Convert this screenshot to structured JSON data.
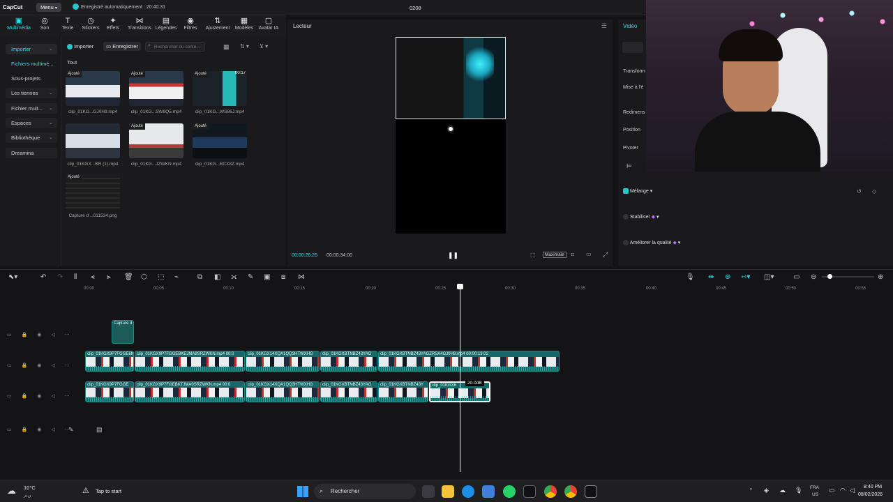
{
  "topbar": {
    "logo": "CapCut",
    "menu": "Menu",
    "autosave": "Enregistré automatiquement : 20:40:31",
    "project_title": "0208"
  },
  "toolbar": {
    "tools": [
      "Multimédia",
      "Son",
      "Texte",
      "Stickers",
      "Effets",
      "Transitions",
      "Légendes",
      "Filtres",
      "Ajustement",
      "Modèles",
      "Avatar IA"
    ]
  },
  "sidebar": {
    "items": [
      {
        "label": "Importer",
        "chevron": true
      },
      {
        "label": "Fichiers multimé...",
        "chevron": false
      },
      {
        "label": "Sous-projets",
        "chevron": false
      },
      {
        "label": "Les tiennes",
        "chevron": true
      },
      {
        "label": "Fichier mult...",
        "chevron": true
      },
      {
        "label": "Espaces",
        "chevron": true
      },
      {
        "label": "Bibliothèque",
        "chevron": true
      },
      {
        "label": "Dreamina",
        "chevron": false
      }
    ]
  },
  "media": {
    "import_btn": "Importer",
    "record_btn": "Enregistrer",
    "search_placeholder": "Rechercher du conte...",
    "filter_all": "Tout",
    "badge": "Ajouté",
    "items": [
      {
        "name": "clip_01KG...GJ0H9.mp4",
        "duration": ""
      },
      {
        "name": "clip_01KG...SW9Q5.mp4",
        "duration": ""
      },
      {
        "name": "clip_01KG...WS86J.mp4",
        "duration": "00:17"
      },
      {
        "name": "clip_01KGX...BR (1).mp4",
        "duration": ""
      },
      {
        "name": "clip_01KG...JZWKN.mp4",
        "duration": ""
      },
      {
        "name": "clip_01KG...BCX8Z.mp4",
        "duration": ""
      },
      {
        "name": "Capture d'...011534.png",
        "duration": ""
      }
    ]
  },
  "player": {
    "title": "Lecteur",
    "current_time": "00:00:26:25",
    "total_time": "00:00:34:00",
    "ratio_btn": "Maximale"
  },
  "props": {
    "tab": "Vidéo",
    "labels": [
      "Transform",
      "Mise à l'é",
      "Redimens",
      "Position",
      "Pivoter"
    ],
    "blend": "Mélange",
    "stabilize": "Stabiliser",
    "enhance": "Améliorer la qualité"
  },
  "timeline": {
    "ticks": [
      "00:00",
      "00:05",
      "00:10",
      "00:15",
      "00:20",
      "00:25",
      "00:30",
      "00:35",
      "00:40",
      "00:45",
      "00:50",
      "00:55"
    ],
    "caption_clip": "Capture d",
    "track1_labels": [
      "clip_01KGX9P7FGGE6K",
      "clip_01KGX9P7FGGEBKEJMA8SRZWKN.mp4",
      "00:0",
      "clip_01KGX14XQA1QQ3HTWXHG",
      "clip_01KGXBTNBZ43YAG",
      "clip_01KGXBTNBZ43YAGZRSA4GJ0H9.mp4",
      "00:00:13:02"
    ],
    "track2_labels": [
      "clip_01KGX9P7FGGE",
      "clip_01KGX9P7FGEBKTJMA0SRZWKN.mp4",
      "00:0",
      "clip_01KGX14XQA1QQ3HTWXHG",
      "clip_01KGXBTNBZ43YAG",
      "clip_01KGXBTNBZ43Y",
      "clip_01KGX6"
    ],
    "volume_tooltip": "20.0dB"
  },
  "taskbar": {
    "weather_temp": "10°C",
    "weather_sub": "ﻦﺑﺮ",
    "tip": "Tap to start",
    "search": "Rechercher",
    "lang_top": "FRA",
    "lang_bottom": "US",
    "time": "8:40 PM",
    "date": "08/02/2026"
  }
}
